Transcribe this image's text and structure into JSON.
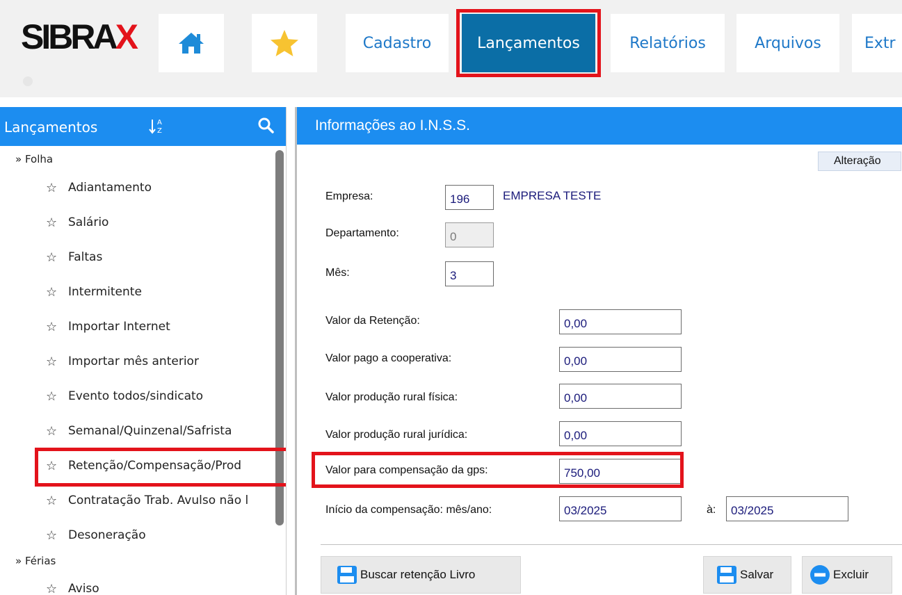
{
  "brand": {
    "logo_text": "SIBRA",
    "logo_x": "X"
  },
  "topnav": {
    "tabs": [
      {
        "label": "Cadastro"
      },
      {
        "label": "Lançamentos",
        "active": true
      },
      {
        "label": "Relatórios"
      },
      {
        "label": "Arquivos"
      },
      {
        "label": "Extr"
      }
    ]
  },
  "sidebar": {
    "title": "Lançamentos",
    "groups": [
      {
        "label": "» Folha"
      },
      {
        "label": "» Férias"
      }
    ],
    "items": [
      {
        "label": "Adiantamento"
      },
      {
        "label": "Salário"
      },
      {
        "label": "Faltas"
      },
      {
        "label": "Intermitente"
      },
      {
        "label": "Importar Internet"
      },
      {
        "label": "Importar mês anterior"
      },
      {
        "label": "Evento todos/sindicato"
      },
      {
        "label": "Semanal/Quinzenal/Safrista"
      },
      {
        "label": "Retenção/Compensação/Prod",
        "highlighted": true
      },
      {
        "label": "Contratação Trab. Avulso não l"
      },
      {
        "label": "Desoneração"
      },
      {
        "label": "Aviso"
      }
    ]
  },
  "form": {
    "title": "Informações ao I.N.S.S.",
    "mode": "Alteração",
    "empresa": {
      "label": "Empresa:",
      "value": "196",
      "name": "EMPRESA TESTE"
    },
    "departamento": {
      "label": "Departamento:",
      "value": "0"
    },
    "mes": {
      "label": "Mês:",
      "value": "3"
    },
    "valor_retencao": {
      "label": "Valor da Retenção:",
      "value": "0,00"
    },
    "valor_cooperativa": {
      "label": "Valor pago a cooperativa:",
      "value": "0,00"
    },
    "valor_rural_fisica": {
      "label": "Valor produção rural física:",
      "value": "0,00"
    },
    "valor_rural_juridica": {
      "label": "Valor produção rural jurídica:",
      "value": "0,00"
    },
    "valor_compensacao": {
      "label": "Valor para compensação da gps:",
      "value": "750,00"
    },
    "inicio_compensacao": {
      "label": "Início da compensação: mês/ano:",
      "from": "03/2025",
      "to_label": "à:",
      "to": "03/2025"
    }
  },
  "buttons": {
    "buscar": "Buscar retenção Livro",
    "salvar": "Salvar",
    "excluir": "Excluir"
  },
  "colors": {
    "accent": "#1c8df0",
    "active_tab": "#0b6ea6",
    "highlight": "#e3131b",
    "brand_red": "#e3131b"
  }
}
